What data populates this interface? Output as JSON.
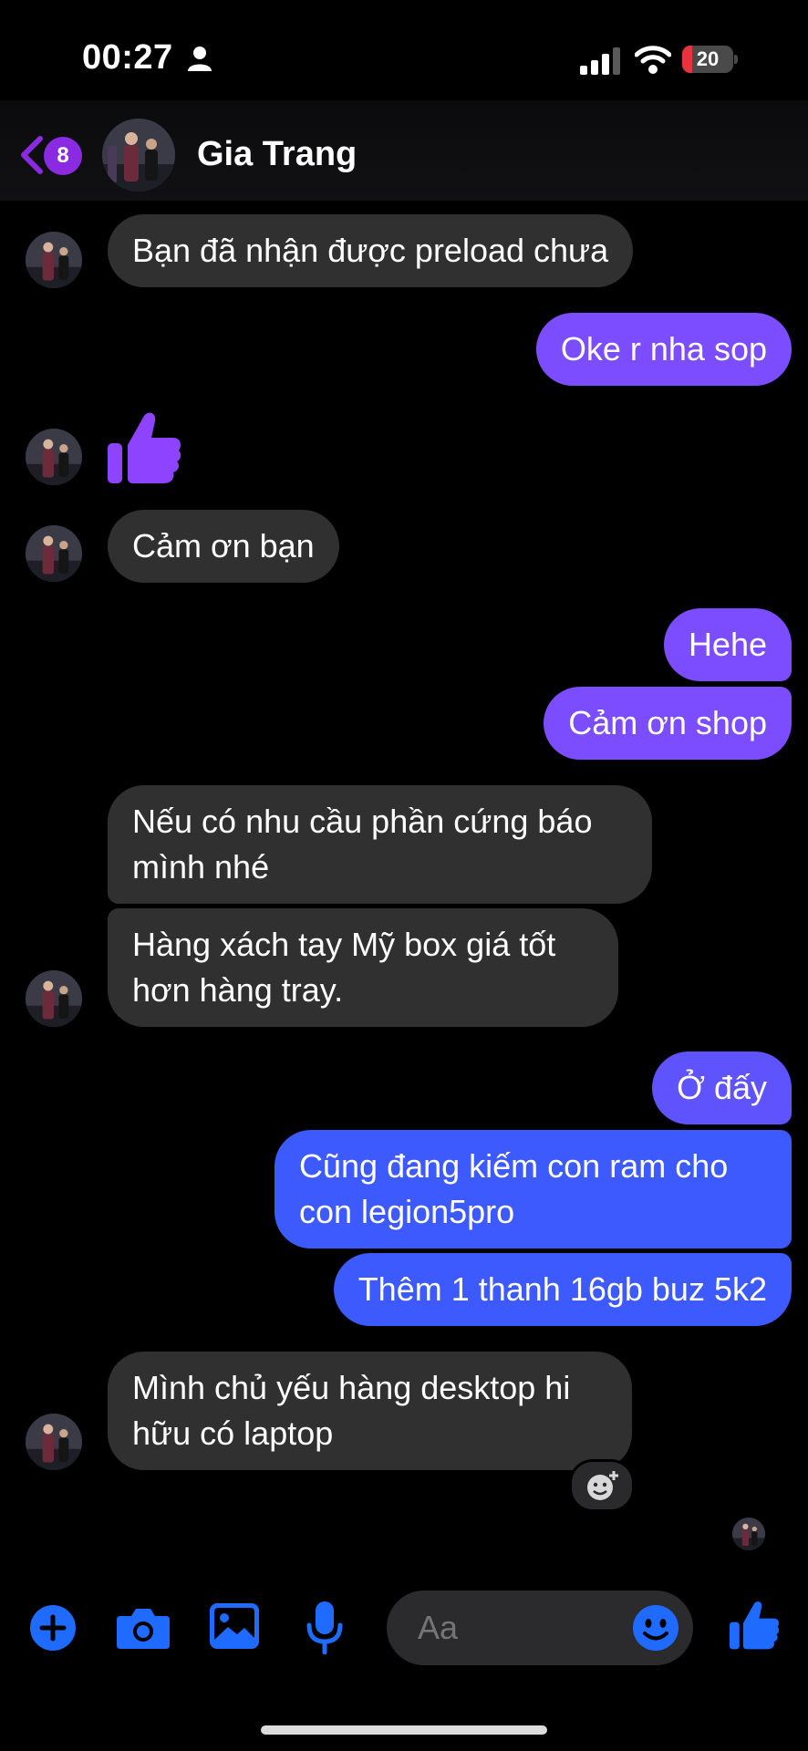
{
  "status_bar": {
    "time": "00:27",
    "battery_level": "20",
    "battery_fraction": 0.2
  },
  "header": {
    "unread_count": "8",
    "contact_name": "Gia Trang"
  },
  "messages": [
    {
      "sender": "contact",
      "text": "Bạn đã nhận được preload chưa"
    },
    {
      "sender": "me",
      "text": "Oke r nha sop"
    },
    {
      "sender": "contact",
      "type": "like",
      "icon": "thumbs-up-icon"
    },
    {
      "sender": "contact",
      "text": "Cảm ơn bạn"
    },
    {
      "sender": "me",
      "text": "Hehe"
    },
    {
      "sender": "me",
      "text": "Cảm ơn shop"
    },
    {
      "sender": "contact",
      "lines": [
        "Nếu có nhu cầu phần cứng báo",
        "mình nhé"
      ]
    },
    {
      "sender": "contact",
      "lines": [
        "Hàng xách tay Mỹ box giá tốt",
        "hơn hàng tray."
      ]
    },
    {
      "sender": "me",
      "text": "Ở đấy"
    },
    {
      "sender": "me",
      "lines": [
        "Cũng đang kiếm con ram cho",
        "con legion5pro"
      ]
    },
    {
      "sender": "me",
      "text": "Thêm 1 thanh 16gb buz 5k2"
    },
    {
      "sender": "contact",
      "lines": [
        "Mình chủ yếu hàng desktop hi",
        "hữu có laptop"
      ]
    }
  ],
  "composer": {
    "placeholder": "Aa"
  },
  "colors": {
    "accent": "#8a2be2",
    "outgoing_purple": "#7c4dff",
    "outgoing_blue": "#3d5afe",
    "incoming": "#303030",
    "toolbar_icons": "#1f6bff"
  }
}
